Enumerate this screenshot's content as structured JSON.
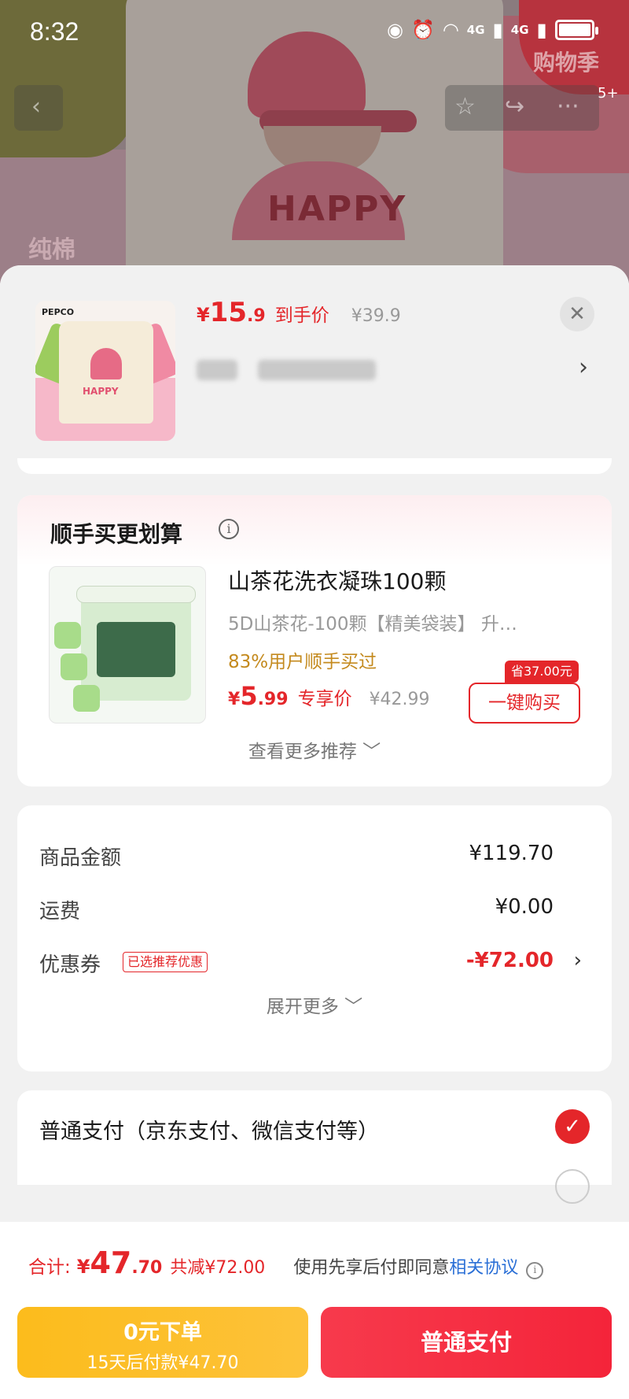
{
  "status_bar": {
    "time": "8:32",
    "network_1": "4G",
    "network_2": "4G"
  },
  "backdrop": {
    "tag": "纯棉",
    "shirt_text": "HAPPY",
    "promo": "购物季",
    "badge": "5+"
  },
  "product": {
    "price_currency": "¥",
    "price_int": "15",
    "price_dec": ".9",
    "price_label": "到手价",
    "original_price": "¥39.9",
    "thumb_brand": "PEPCO",
    "thumb_text": "HAPPY"
  },
  "recommend": {
    "title": "顺手买更划算",
    "item_name": "山茶花洗衣凝珠100颗",
    "item_spec": "5D山茶花-100颗【精美袋装】 升…",
    "social_proof": "83%用户顺手买过",
    "price_currency": "¥",
    "price_int": "5",
    "price_dec": ".99",
    "price_label": "专享价",
    "original_price": "¥42.99",
    "save_badge": "省37.00元",
    "buy_button": "一键购买",
    "more": "查看更多推荐 ﹀"
  },
  "summary": {
    "rows": [
      {
        "label": "商品金额",
        "value": "¥119.70"
      },
      {
        "label": "运费",
        "value": "¥0.00"
      },
      {
        "label": "优惠券",
        "badge": "已选推荐优惠",
        "value": "-¥72.00"
      }
    ],
    "expand": "展开更多 ﹀"
  },
  "payment": {
    "option": "普通支付（京东支付、微信支付等）"
  },
  "bottom": {
    "total_label": "合计:",
    "total_currency": "¥",
    "total_int": "47",
    "total_dec": ".70",
    "reduce": "共减¥72.00",
    "agree_text": "使用先享后付即同意",
    "agree_link": "相关协议",
    "later_line1": "0元下单",
    "later_line2": "15天后付款¥47.70",
    "pay_button": "普通支付"
  },
  "colors": {
    "accent": "#e4262a",
    "yellow_button": "#fcbc1c",
    "link": "#2a6fd6"
  },
  "icons": [
    "eye-icon",
    "alarm-icon",
    "wifi-icon",
    "battery-icon",
    "back-icon",
    "star-icon",
    "share-icon",
    "more-icon",
    "close-icon",
    "chevron-right-icon",
    "info-icon",
    "check-icon"
  ]
}
